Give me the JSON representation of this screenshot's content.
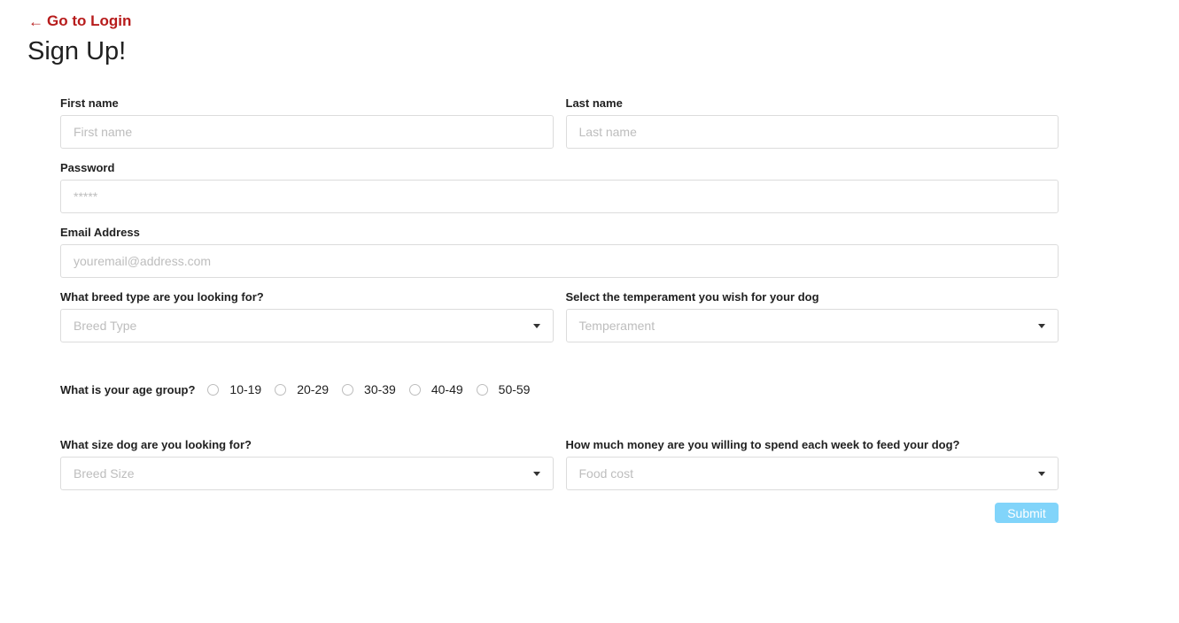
{
  "nav": {
    "back_arrow": "←",
    "back_label": "Go to Login"
  },
  "page": {
    "title": "Sign Up!"
  },
  "form": {
    "first_name": {
      "label": "First name",
      "placeholder": "First name"
    },
    "last_name": {
      "label": "Last name",
      "placeholder": "Last name"
    },
    "password": {
      "label": "Password",
      "placeholder": "*****"
    },
    "email": {
      "label": "Email Address",
      "placeholder": "youremail@address.com"
    },
    "breed_type": {
      "label": "What breed type are you looking for?",
      "placeholder": "Breed Type"
    },
    "temperament": {
      "label": "Select the temperament you wish for your dog",
      "placeholder": "Temperament"
    },
    "age_group": {
      "label": "What is your age group?",
      "options": [
        "10-19",
        "20-29",
        "30-39",
        "40-49",
        "50-59"
      ]
    },
    "breed_size": {
      "label": "What size dog are you looking for?",
      "placeholder": "Breed Size"
    },
    "food_cost": {
      "label": "How much money are you willing to spend each week to feed your dog?",
      "placeholder": "Food cost"
    },
    "submit_label": "Submit"
  },
  "colors": {
    "link": "#b71c1c",
    "submit_bg": "#81d4fa",
    "border": "#dcdcdc",
    "placeholder": "#bdbdbd"
  },
  "icons": {
    "back": "arrow-left-icon",
    "dropdown": "caret-down-icon",
    "radio": "radio-unchecked-icon"
  }
}
